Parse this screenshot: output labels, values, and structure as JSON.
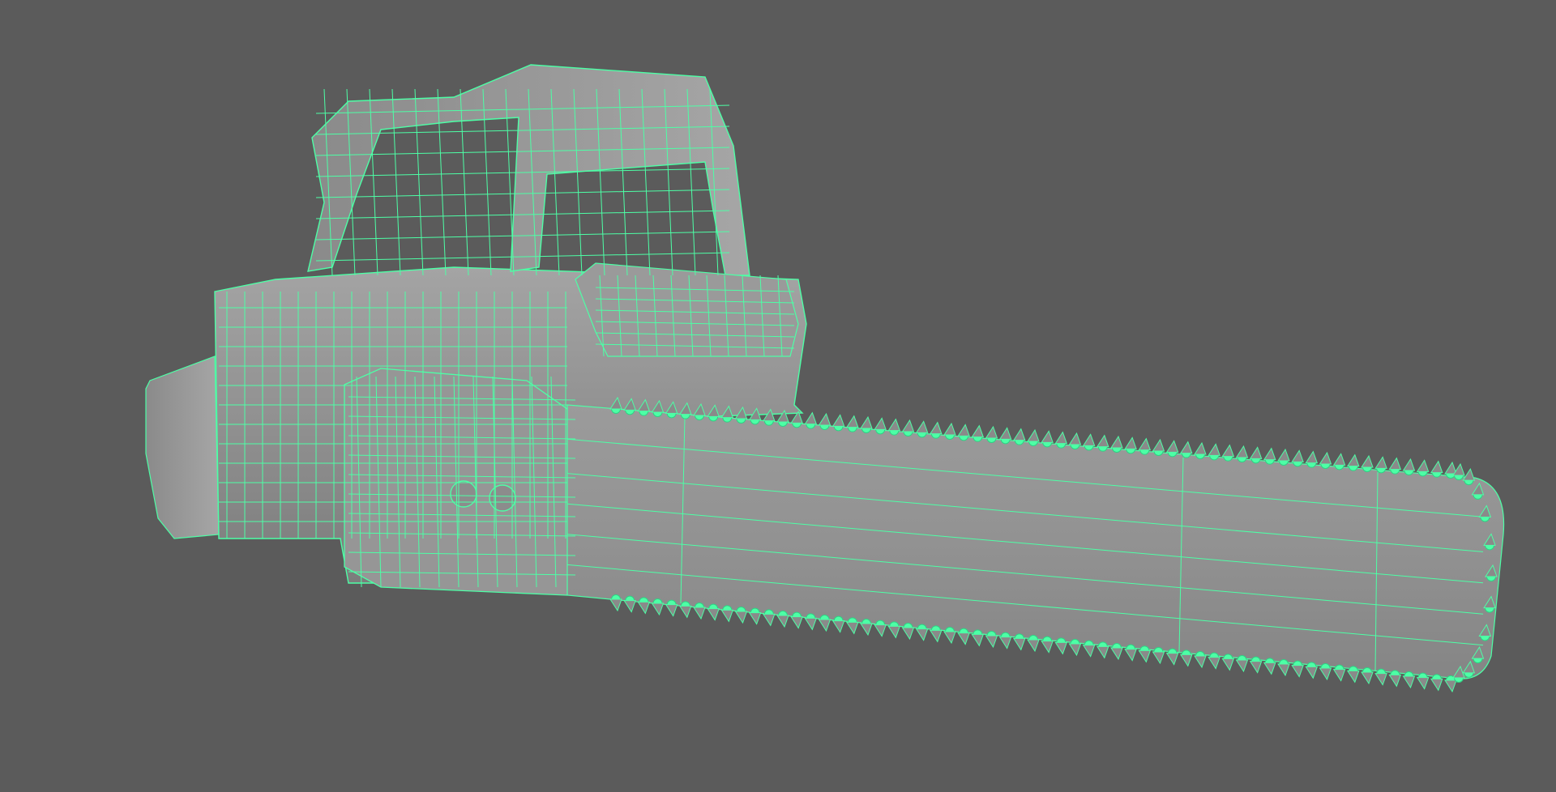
{
  "viewport": {
    "background_color": "#5b5b5b",
    "object": "chainsaw",
    "display_mode": "wireframe-on-shaded",
    "wireframe_color": "#4dffa6",
    "shaded_color": "#8e8e8e",
    "selected": true
  }
}
